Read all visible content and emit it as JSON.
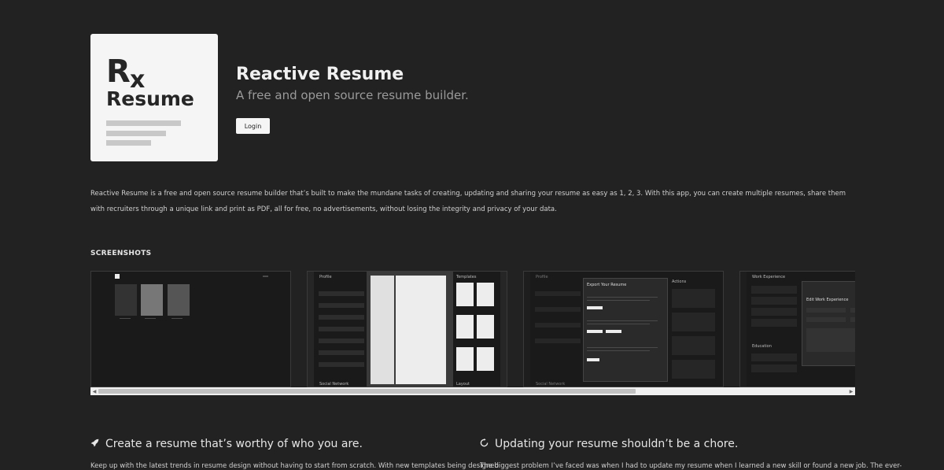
{
  "app": {
    "logo_r": "R",
    "logo_x": "x",
    "logo_word": "Resume",
    "title": "Reactive Resume",
    "tagline": "A free and open source resume builder.",
    "login_label": "Login"
  },
  "description": "Reactive Resume is a free and open source resume builder that’s built to make the mundane tasks of creating, updating and sharing your resume as easy as 1, 2, 3. With this app, you can create multiple resumes, share them with recruiters through a unique link and print as PDF, all for free, no advertisements, without losing the integrity and privacy of your data.",
  "screenshots": {
    "heading": "SCREENSHOTS",
    "shot2": {
      "left_panel": "Profile",
      "right_panel": "Templates",
      "bottom_left": "Social Network",
      "bottom_right": "Layout"
    },
    "shot3": {
      "left_panel": "Profile",
      "dialog_title": "Export Your Resume",
      "right_panel": "Actions",
      "bottom_left": "Social Network"
    },
    "shot4": {
      "left_panel": "Work Experience",
      "dialog_title": "Edit Work Experience",
      "section2": "Education"
    },
    "scroll_left": "◀",
    "scroll_right": "▶"
  },
  "features": [
    {
      "icon": "rocket-icon",
      "glyph": "🚀",
      "title": "Create a resume that’s worthy of who you are.",
      "body": "Keep up with the latest trends in resume design without having to start from scratch. With new templates being designed"
    },
    {
      "icon": "refresh-icon",
      "glyph": "↻",
      "title": "Updating your resume shouldn’t be a chore.",
      "body": "The biggest problem I’ve faced was when I had to update my resume when I learned a new skill or found a new job. The ever-"
    }
  ],
  "colors": {
    "background": "#222222",
    "card": "#f5f5f5",
    "accent_text": "#e6e6e6"
  }
}
